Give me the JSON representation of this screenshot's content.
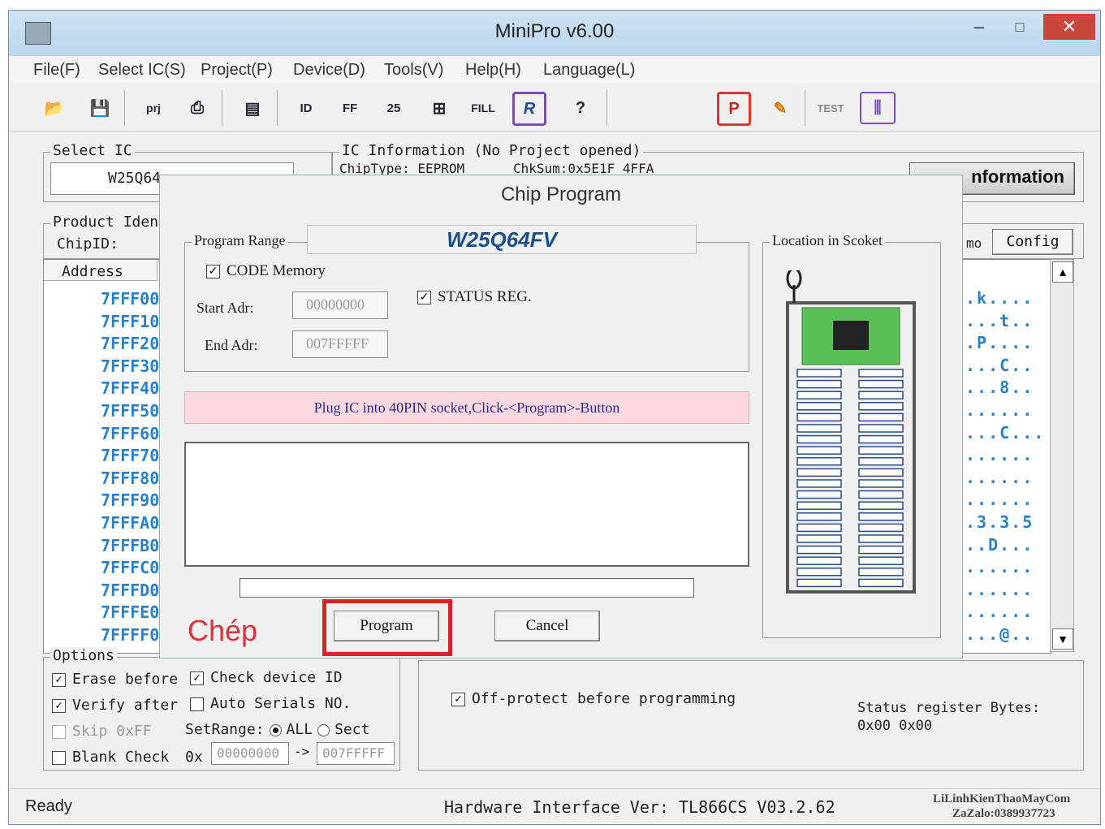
{
  "window": {
    "title": "MiniPro v6.00",
    "min": "–",
    "max": "□",
    "close": "✕"
  },
  "menu": [
    "File(F)",
    "Select IC(S)",
    "Project(P)",
    "Device(D)",
    "Tools(V)",
    "Help(H)",
    "Language(L)"
  ],
  "toolbar": {
    "icons": [
      "open-icon",
      "save-icon",
      "open-project-icon",
      "save-project-icon",
      "chip-info-icon",
      "read-icon",
      "verify-icon",
      "blank-check-icon",
      "erase-icon",
      "fill-icon",
      "program-icon",
      "help-icon",
      "encrypt-icon",
      "edit-icon",
      "test-icon",
      "socket-icon"
    ]
  },
  "select_ic": {
    "label": "Select IC",
    "value": "W25Q64"
  },
  "ic_info": {
    "label": "IC Information (No Project opened)",
    "chiptype": "ChipType:  EEPROM",
    "chksum": "ChkSum:0x5E1F 4FFA",
    "button": "nformation"
  },
  "product": {
    "label": "Product Iden",
    "chipid": "ChipID:",
    "demo": "mo",
    "config": "Config"
  },
  "hex": {
    "header": "Address",
    "rows": [
      "7FFF00:",
      "7FFF10:",
      "7FFF20:",
      "7FFF30:",
      "7FFF40:",
      "7FFF50:",
      "7FFF60:",
      "7FFF70:",
      "7FFF80:",
      "7FFF90:",
      "7FFFA0:",
      "7FFFB0:",
      "7FFFC0:",
      "7FFFD0:",
      "7FFFE0:",
      "7FFFF0:"
    ],
    "ascii": [
      ".k....",
      "...t..",
      ".P....",
      "...C..",
      "...8..",
      "......",
      "...C...",
      "......",
      "......",
      "......",
      ".3.3.5",
      "..D...",
      "......",
      "......",
      "......",
      "...@.."
    ]
  },
  "dialog": {
    "title": "Chip Program",
    "chip": "W25Q64FV",
    "range_label": "Program Range",
    "code_memory": "CODE Memory",
    "status_reg": "STATUS REG.",
    "start_label": "Start Adr:",
    "start_value": "00000000",
    "end_label": "End Adr:",
    "end_value": "007FFFFF",
    "message": "Plug IC into 40PIN socket,Click-<Program>-Button",
    "program": "Program",
    "cancel": "Cancel",
    "socket_label": "Location in Scoket",
    "annotation": "Chép",
    "progress": 0
  },
  "options": {
    "label": "Options",
    "erase": "Erase before",
    "check_id": "Check device ID",
    "verify": "Verify after",
    "auto_serial": "Auto Serials NO.",
    "skip": "Skip 0xFF",
    "setrange": "SetRange:",
    "all": "ALL",
    "sect": "Sect",
    "blank": "Blank Check",
    "ox": "0x",
    "from": "00000000",
    "arrow": "->",
    "to": "007FFFFF",
    "offprotect": "Off-protect before programming",
    "status_reg_bytes": "Status register Bytes:",
    "status_reg_values": "0x00 0x00"
  },
  "statusbar": {
    "ready": "Ready",
    "hw": "Hardware Interface Ver: TL866CS V03.2.62",
    "wm1": "LiLinhKienThaoMayCom",
    "wm2": "ZaZalo:0389937723"
  }
}
